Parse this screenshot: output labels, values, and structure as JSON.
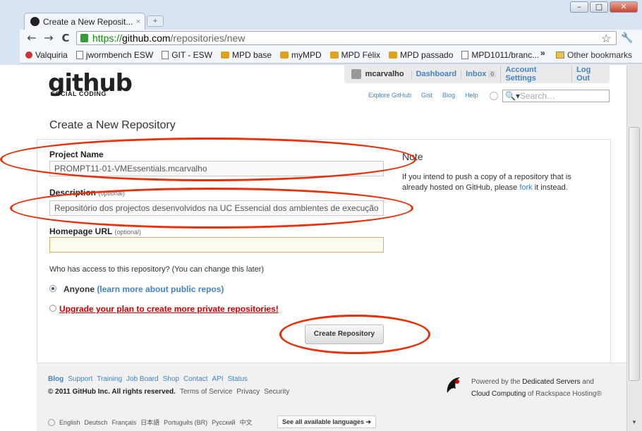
{
  "window": {
    "minimize": "–",
    "maximize": "□",
    "close": "✕"
  },
  "tab": {
    "title": "Create a New Reposit...",
    "close": "×"
  },
  "toolbar": {
    "back": "←",
    "forward": "→",
    "reload": "C",
    "url_scheme": "https://",
    "url_host": "github.com",
    "url_path": "/repositories/new"
  },
  "bookmarks": [
    {
      "label": "Valquiria",
      "icon": "bug-icon"
    },
    {
      "label": "jwormbench ESW",
      "icon": "page-icon"
    },
    {
      "label": "GIT - ESW",
      "icon": "page-icon"
    },
    {
      "label": "MPD base",
      "icon": "mpd-icon"
    },
    {
      "label": "myMPD",
      "icon": "mpd-icon"
    },
    {
      "label": "MPD Félix",
      "icon": "mpd-icon"
    },
    {
      "label": "MPD passado",
      "icon": "mpd-icon"
    },
    {
      "label": "MPD1011/branc...",
      "icon": "page-icon"
    }
  ],
  "bookmarks_more": "»",
  "other_bookmarks": "Other bookmarks",
  "header": {
    "logo": "github",
    "logo_sub": "SOCIAL CODING",
    "username": "mcarvalho",
    "dashboard": "Dashboard",
    "inbox": "Inbox",
    "inbox_count": "0",
    "account_settings": "Account Settings",
    "logout": "Log Out",
    "explore": "Explore GitHub",
    "gist": "Gist",
    "blog": "Blog",
    "help": "Help",
    "search_placeholder": "Search…"
  },
  "form": {
    "title": "Create a New Repository",
    "project_name_label": "Project Name",
    "project_name_value": "PROMPT11-01-VMEssentials.mcarvalho",
    "description_label": "Description",
    "description_optional": "(optional)",
    "description_value": "Repositório dos projectos desenvolvidos na UC Essencial dos ambientes de execução",
    "homepage_label": "Homepage URL",
    "homepage_optional": "(optional)",
    "homepage_value": "",
    "access_question": "Who has access to this repository? (You can change this later)",
    "anyone_label": "Anyone",
    "anyone_link": "(learn more about public repos)",
    "upgrade_link": "Upgrade your plan to create more private repositories!",
    "create_button": "Create Repository"
  },
  "note": {
    "title": "Note",
    "text_before": "If you intend to push a copy of a repository that is already hosted on GitHub, please ",
    "link": "fork",
    "text_after": " it instead."
  },
  "footer": {
    "links": [
      "Blog",
      "Support",
      "Training",
      "Job Board",
      "Shop",
      "Contact",
      "API",
      "Status"
    ],
    "copyright": "© 2011 GitHub Inc. All rights reserved.",
    "legal": [
      "Terms of Service",
      "Privacy",
      "Security"
    ],
    "powered_1": "Powered by the ",
    "powered_bold_1": "Dedicated Servers",
    "powered_2": " and",
    "powered_bold_2": "Cloud Computing",
    "powered_3": " of Rackspace Hosting®",
    "languages": [
      "English",
      "Deutsch",
      "Français",
      "日本語",
      "Português (BR)",
      "Русский",
      "中文"
    ],
    "all_languages": "See all available languages ➜"
  },
  "colors": {
    "annotation_ellipse": "#e8300a",
    "link": "#4183c4",
    "upgrade": "#cc0000"
  }
}
